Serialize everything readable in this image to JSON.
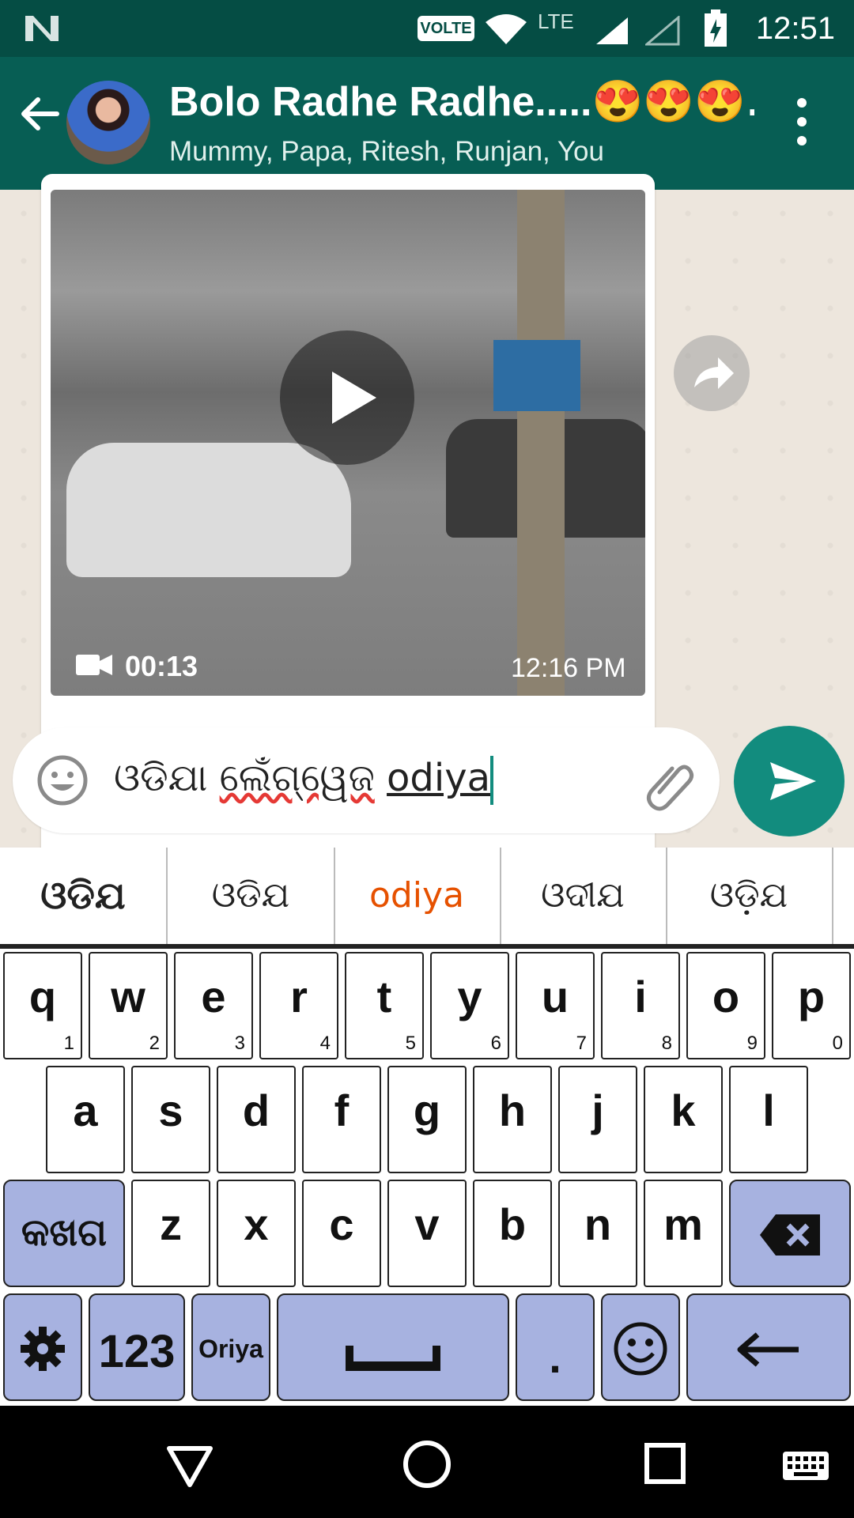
{
  "status_bar": {
    "time": "12:51",
    "volte": "VOLTE",
    "network": "LTE"
  },
  "header": {
    "title": "Bolo Radhe Radhe.....😍😍😍…",
    "subtitle": "Mummy, Papa, Ritesh, Runjan, You"
  },
  "message": {
    "duration": "00:13",
    "time": "12:16 PM"
  },
  "input": {
    "existing": "ଓଡିଯା",
    "misspelled": "ଲେଁଗ୍ୱେଜ",
    "typed": "odiya"
  },
  "suggestions": [
    "ଓଡିଯ",
    "ଓଡିଯ",
    "odiya",
    "ଓଦୀଯ",
    "ଓଡ଼ିଯ"
  ],
  "keyboard": {
    "row1": [
      [
        "q",
        "1"
      ],
      [
        "w",
        "2"
      ],
      [
        "e",
        "3"
      ],
      [
        "r",
        "4"
      ],
      [
        "t",
        "5"
      ],
      [
        "y",
        "6"
      ],
      [
        "u",
        "7"
      ],
      [
        "i",
        "8"
      ],
      [
        "o",
        "9"
      ],
      [
        "p",
        "0"
      ]
    ],
    "row2": [
      "a",
      "s",
      "d",
      "f",
      "g",
      "h",
      "j",
      "k",
      "l"
    ],
    "row3": [
      "z",
      "x",
      "c",
      "v",
      "b",
      "n",
      "m"
    ],
    "shift_label": "କଖଗ",
    "num_label": "123",
    "lang_label": "Oriya",
    "period": "."
  },
  "colors": {
    "header": "#075e54",
    "statusbar": "#054d44",
    "send": "#128c7e",
    "fn_key": "#a7b2e0"
  }
}
